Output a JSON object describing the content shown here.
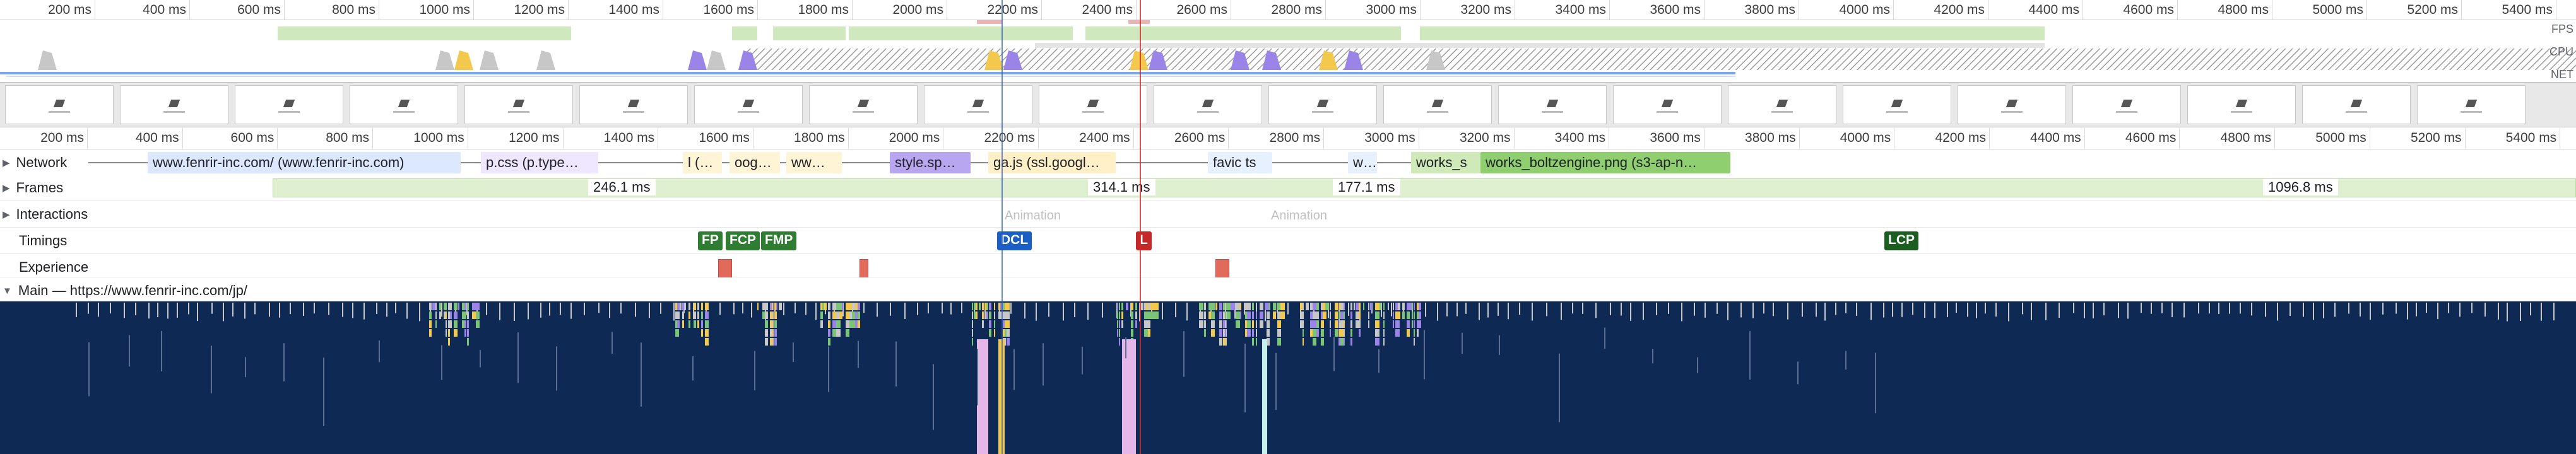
{
  "overview_ticks": [
    "200 ms",
    "400 ms",
    "600 ms",
    "800 ms",
    "1000 ms",
    "1200 ms",
    "1400 ms",
    "1600 ms",
    "1800 ms",
    "2000 ms",
    "2200 ms",
    "2400 ms",
    "2600 ms",
    "2800 ms",
    "3000 ms",
    "3200 ms",
    "3400 ms",
    "3600 ms",
    "3800 ms",
    "4000 ms",
    "4200 ms",
    "4400 ms",
    "4600 ms",
    "4800 ms",
    "5000 ms",
    "5200 ms",
    "5400 ms"
  ],
  "overview_side_labels": {
    "fps": "FPS",
    "cpu": "CPU",
    "net": "NET"
  },
  "flame_ticks": [
    "200 ms",
    "400 ms",
    "600 ms",
    "800 ms",
    "1000 ms",
    "1200 ms",
    "1400 ms",
    "1600 ms",
    "1800 ms",
    "2000 ms",
    "2200 ms",
    "2400 ms",
    "2600 ms",
    "2800 ms",
    "3000 ms",
    "3200 ms",
    "3400 ms",
    "3600 ms",
    "3800 ms",
    "4000 ms",
    "4200 ms",
    "4400 ms",
    "4600 ms",
    "4800 ms",
    "5000 ms",
    "5200 ms",
    "5400 ms"
  ],
  "tracks": {
    "network": "Network",
    "frames": "Frames",
    "interactions": "Interactions",
    "timings": "Timings",
    "experience": "Experience",
    "main": "Main — https://www.fenrir-inc.com/jp/"
  },
  "network_requests": [
    {
      "label": "www.fenrir-inc.com/ (www.fenrir-inc.com)",
      "color": "#dbe8ff"
    },
    {
      "label": "p.css (p.type…",
      "color": "#efe6ff"
    },
    {
      "label": "l (…",
      "color": "#fff4d6"
    },
    {
      "label": "oog…",
      "color": "#fff4d6"
    },
    {
      "label": "ww…",
      "color": "#fff4d6"
    },
    {
      "label": "style.sp…",
      "color": "#b8a6f0"
    },
    {
      "label": "ga.js (ssl.googl…",
      "color": "#fff0c8"
    },
    {
      "label": "favic ts",
      "color": "#e6f0ff"
    },
    {
      "label": "w…",
      "color": "#e6f0ff"
    },
    {
      "label": "works_s",
      "color": "#cfe9b8"
    },
    {
      "label": "works_boltzengine.png (s3-ap-n…",
      "color": "#8fcf6f"
    }
  ],
  "frame_durations": [
    "246.1 ms",
    "314.1 ms",
    "177.1 ms",
    "1096.8 ms"
  ],
  "interaction_labels": [
    "Animation",
    "Animation"
  ],
  "timings": [
    {
      "label": "FP",
      "color": "#2e7d32"
    },
    {
      "label": "FCP",
      "color": "#2e7d32"
    },
    {
      "label": "FMP",
      "color": "#2e7d32"
    },
    {
      "label": "DCL",
      "color": "#1a5fc4"
    },
    {
      "label": "L",
      "color": "#c62828"
    },
    {
      "label": "LCP",
      "color": "#1b5e20"
    }
  ],
  "colors": {
    "main_background": "#0f2955",
    "scripting": "#f2c94c",
    "rendering": "#9b84e8",
    "painting": "#7cc576",
    "system": "#c7c7c7",
    "idle_hatch": "#9a9a9a"
  }
}
